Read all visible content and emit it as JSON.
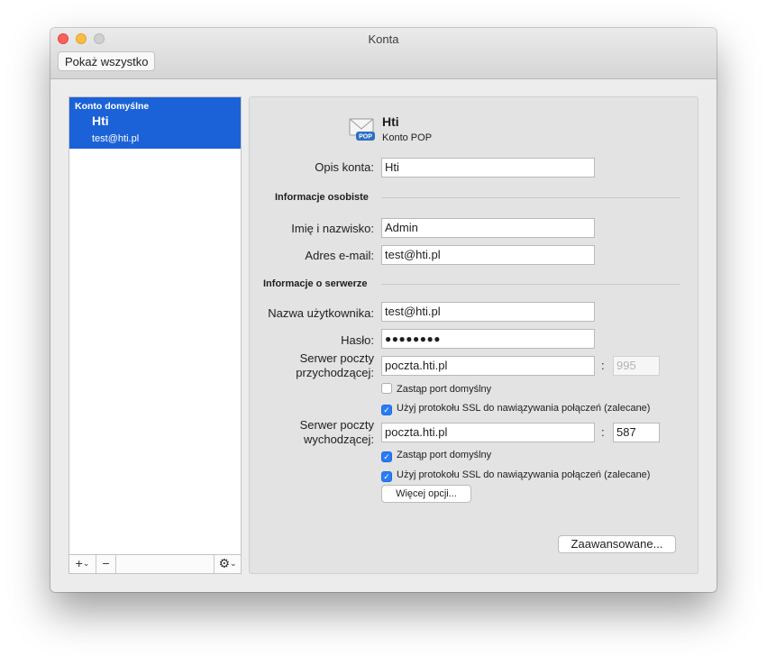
{
  "window": {
    "title": "Konta",
    "show_all_label": "Pokaż wszystko"
  },
  "sidebar": {
    "group_label": "Konto domyślne",
    "accounts": [
      {
        "name": "Hti",
        "email": "test@hti.pl"
      }
    ],
    "add_label": "+",
    "remove_label": "−"
  },
  "account": {
    "name": "Hti",
    "type": "Konto POP",
    "icon_badge": "POP"
  },
  "form": {
    "description_label": "Opis konta:",
    "description_value": "Hti",
    "personal_section": "Informacje osobiste",
    "fullname_label": "Imię i nazwisko:",
    "fullname_value": "Admin",
    "email_label": "Adres e-mail:",
    "email_value": "test@hti.pl",
    "server_section": "Informacje o serwerze",
    "username_label": "Nazwa użytkownika:",
    "username_value": "test@hti.pl",
    "password_label": "Hasło:",
    "password_value": "●●●●●●●●",
    "incoming_label_1": "Serwer poczty",
    "incoming_label_2": "przychodzącej:",
    "incoming_server": "poczta.hti.pl",
    "incoming_port": "995",
    "incoming_override_port": "Zastąp port domyślny",
    "incoming_override_checked": false,
    "incoming_ssl": "Użyj protokołu SSL do nawiązywania połączeń (zalecane)",
    "incoming_ssl_checked": true,
    "outgoing_label_1": "Serwer poczty",
    "outgoing_label_2": "wychodzącej:",
    "outgoing_server": "poczta.hti.pl",
    "outgoing_port": "587",
    "outgoing_override_port": "Zastąp port domyślny",
    "outgoing_override_checked": true,
    "outgoing_ssl": "Użyj protokołu SSL do nawiązywania połączeń (zalecane)",
    "outgoing_ssl_checked": true,
    "more_options_label": "Więcej opcji...",
    "advanced_label": "Zaawansowane...",
    "port_colon": ":"
  },
  "icons": {
    "close": "close-icon",
    "minimize": "minimize-icon",
    "zoom": "zoom-icon",
    "mail": "envelope-icon",
    "gear": "gear-icon",
    "chevron": "chevron-down-icon",
    "check": "checkmark-icon"
  },
  "colors": {
    "selection": "#1b62d8",
    "checkbox_on": "#2a7cf5",
    "close": "#fc605c",
    "minimize": "#fdbc40"
  }
}
